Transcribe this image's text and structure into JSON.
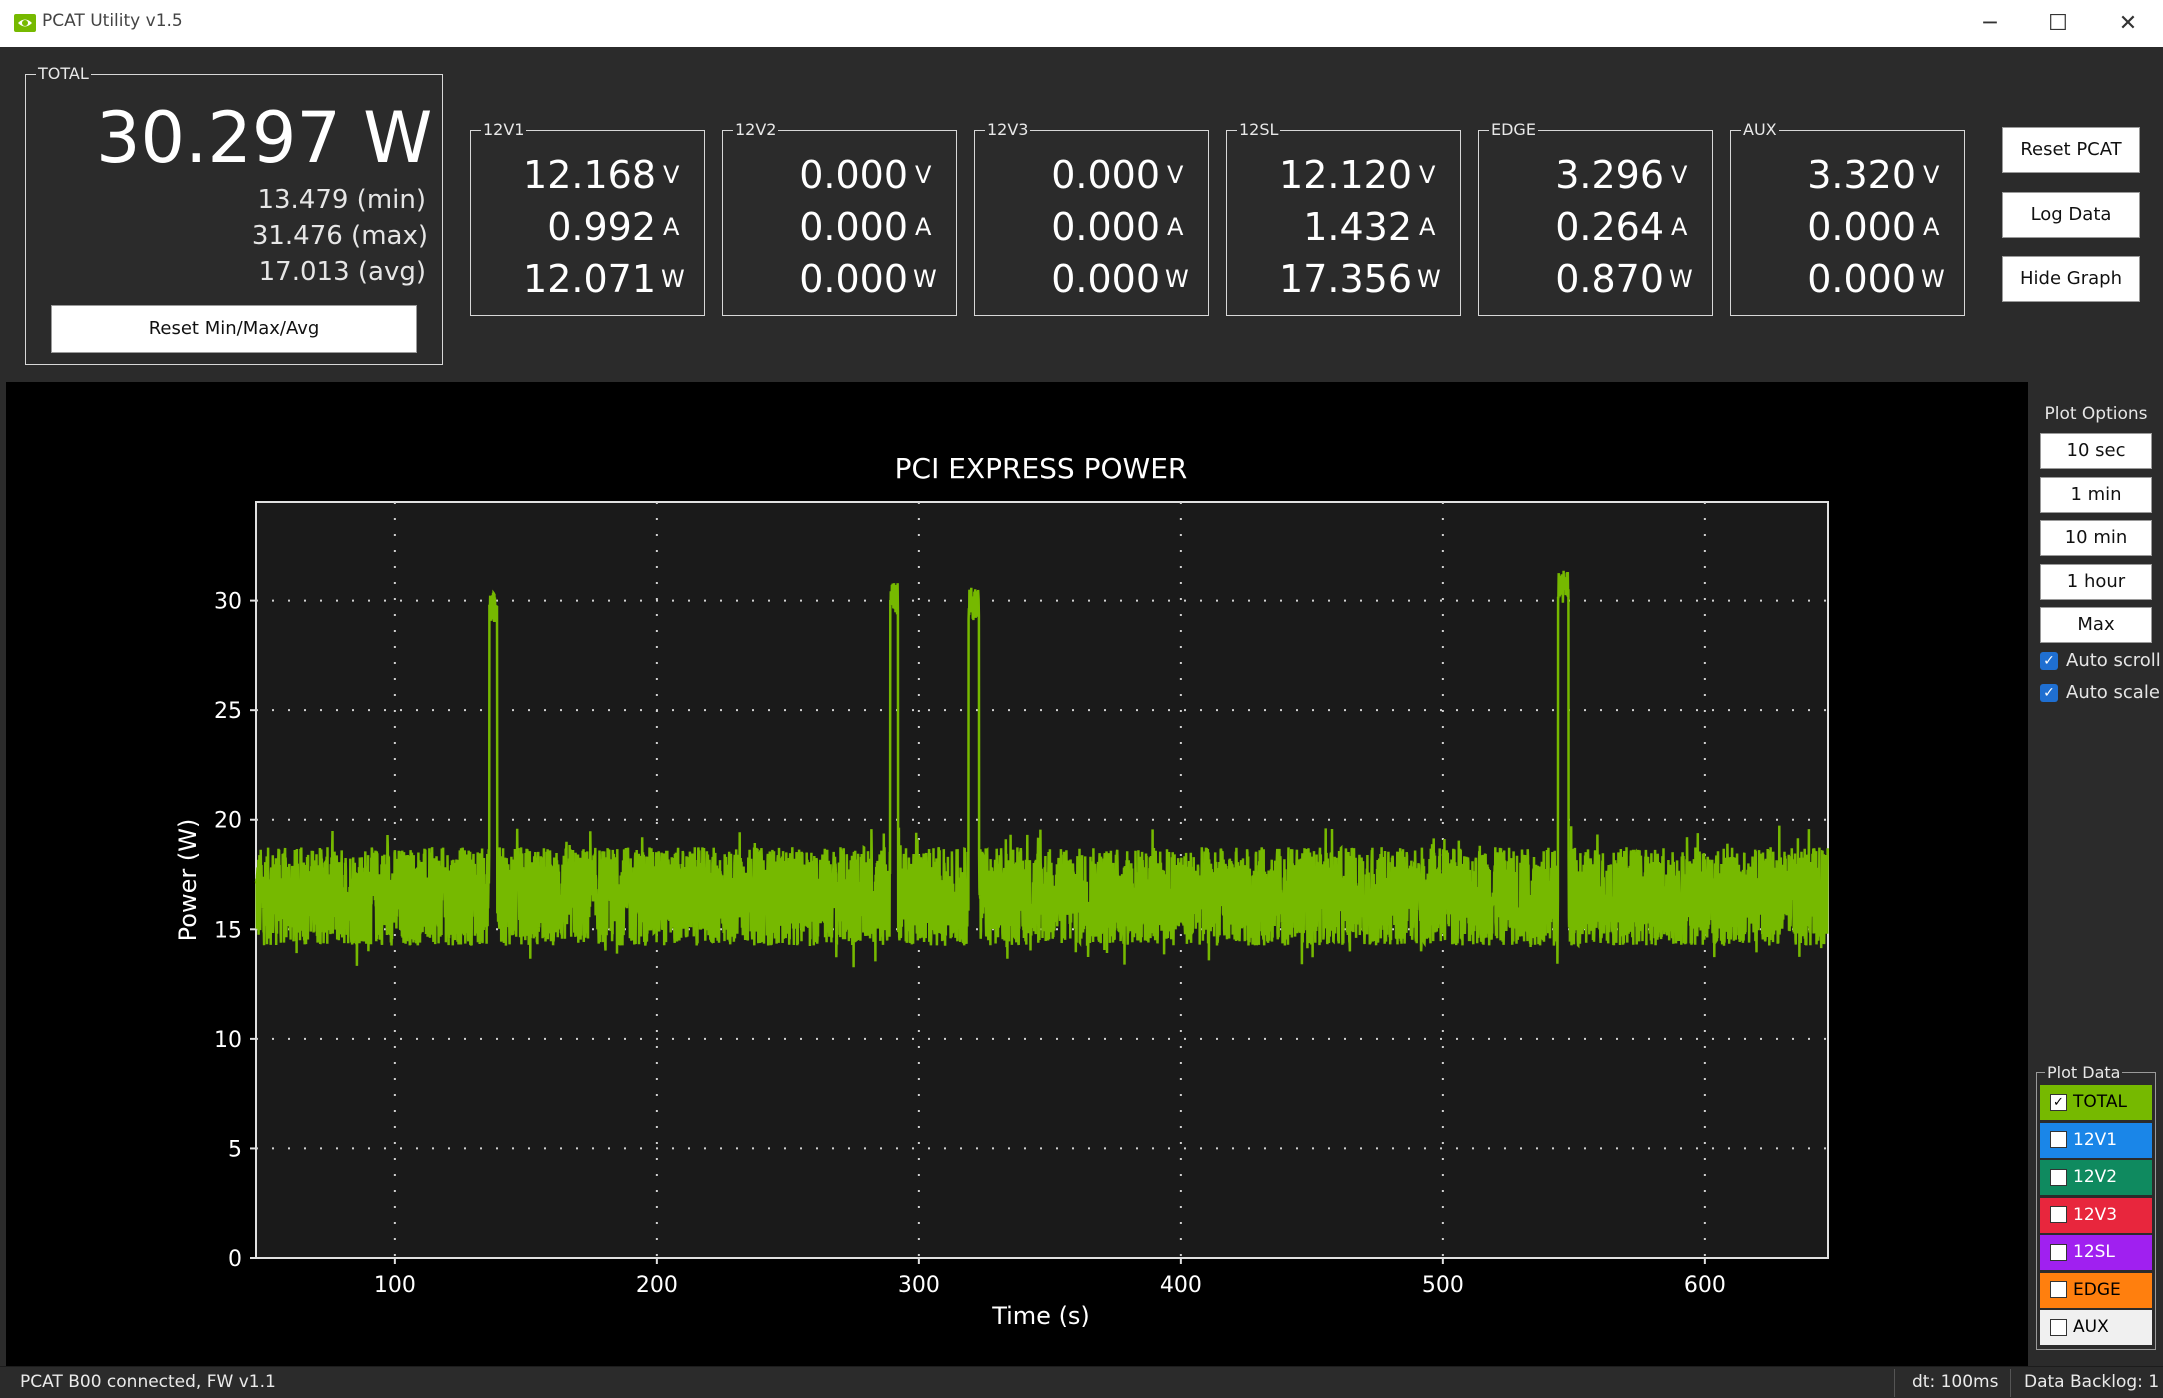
{
  "window": {
    "title": "PCAT Utility v1.5",
    "minimize_glyph": "─",
    "maximize_glyph": "☐",
    "close_glyph": "✕"
  },
  "total": {
    "label": "TOTAL",
    "power": "30.297 W",
    "min": "13.479 (min)",
    "max": "31.476 (max)",
    "avg": "17.013 (avg)",
    "reset_button": "Reset Min/Max/Avg"
  },
  "rails": [
    {
      "label": "12V1",
      "volts": "12.168",
      "amps": "0.992",
      "watts": "12.071",
      "v_unit": "V",
      "a_unit": "A",
      "w_unit": "W"
    },
    {
      "label": "12V2",
      "volts": "0.000",
      "amps": "0.000",
      "watts": "0.000",
      "v_unit": "V",
      "a_unit": "A",
      "w_unit": "W"
    },
    {
      "label": "12V3",
      "volts": "0.000",
      "amps": "0.000",
      "watts": "0.000",
      "v_unit": "V",
      "a_unit": "A",
      "w_unit": "W"
    },
    {
      "label": "12SL",
      "volts": "12.120",
      "amps": "1.432",
      "watts": "17.356",
      "v_unit": "V",
      "a_unit": "A",
      "w_unit": "W"
    },
    {
      "label": "EDGE",
      "volts": "3.296",
      "amps": "0.264",
      "watts": "0.870",
      "v_unit": "V",
      "a_unit": "A",
      "w_unit": "W"
    },
    {
      "label": "AUX",
      "volts": "3.320",
      "amps": "0.000",
      "watts": "0.000",
      "v_unit": "V",
      "a_unit": "A",
      "w_unit": "W"
    }
  ],
  "actions": {
    "reset_pcat": "Reset PCAT",
    "log_data": "Log Data",
    "hide_graph": "Hide Graph"
  },
  "plot_options": {
    "title": "Plot Options",
    "buttons": [
      "10 sec",
      "1 min",
      "10 min",
      "1 hour",
      "Max"
    ],
    "auto_scroll": "Auto scroll",
    "auto_scale": "Auto scale",
    "check_glyph": "✓"
  },
  "plot_data": {
    "title": "Plot Data",
    "checked_glyph": "✓",
    "items": [
      {
        "label": "TOTAL",
        "color": "#76b900",
        "checked": true,
        "text_color": "#000000"
      },
      {
        "label": "12V1",
        "color": "#1a86e8",
        "checked": false,
        "text_color": "#ffffff"
      },
      {
        "label": "12V2",
        "color": "#0f8a5f",
        "checked": false,
        "text_color": "#ffffff"
      },
      {
        "label": "12V3",
        "color": "#e8263d",
        "checked": false,
        "text_color": "#ffffff"
      },
      {
        "label": "12SL",
        "color": "#a020f0",
        "checked": false,
        "text_color": "#ffffff"
      },
      {
        "label": "EDGE",
        "color": "#ff7f0e",
        "checked": false,
        "text_color": "#000000"
      },
      {
        "label": "AUX",
        "color": "#f0f0f0",
        "checked": false,
        "text_color": "#000000"
      }
    ]
  },
  "status": {
    "connection": "PCAT B00 connected, FW v1.1",
    "dt": "dt: 100ms",
    "backlog": "Data Backlog: 1"
  },
  "colors": {
    "series": "#76b900",
    "plot_bg": "#1a1a1a",
    "grid": "#cccccc"
  },
  "chart_data": {
    "type": "line",
    "title": "PCI EXPRESS POWER",
    "xlabel": "Time (s)",
    "ylabel": "Power (W)",
    "xlim": [
      47,
      647
    ],
    "ylim": [
      0,
      30
    ],
    "xticks": [
      100,
      200,
      300,
      400,
      500,
      600
    ],
    "yticks": [
      0,
      5,
      10,
      15,
      20,
      25,
      30
    ],
    "grid": true,
    "baseline": {
      "mean": 16.5,
      "min": 14.5,
      "max": 19.5
    },
    "spikes": [
      {
        "start": 136,
        "end": 139,
        "peak": 30.5
      },
      {
        "start": 289,
        "end": 292,
        "peak": 30.8
      },
      {
        "start": 319,
        "end": 323,
        "peak": 30.6
      },
      {
        "start": 544,
        "end": 548,
        "peak": 31.4
      }
    ],
    "series": [
      {
        "name": "TOTAL",
        "color": "#76b900"
      }
    ]
  }
}
